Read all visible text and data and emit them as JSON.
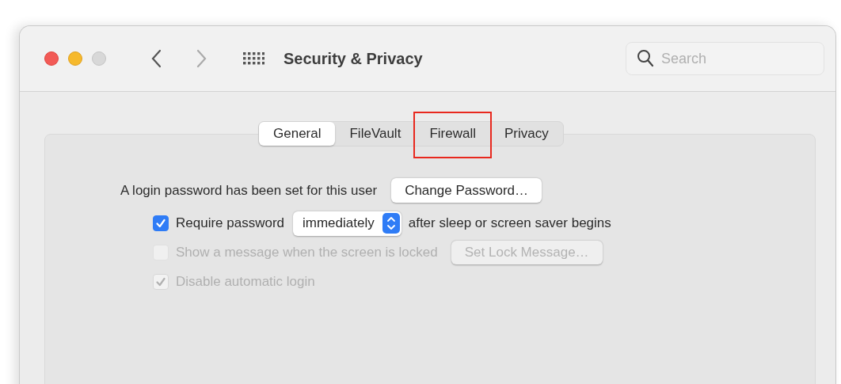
{
  "window": {
    "title": "Security & Privacy"
  },
  "search": {
    "placeholder": "Search"
  },
  "tabs": [
    {
      "label": "General",
      "selected": true,
      "highlighted": false
    },
    {
      "label": "FileVault",
      "selected": false,
      "highlighted": false
    },
    {
      "label": "Firewall",
      "selected": false,
      "highlighted": true
    },
    {
      "label": "Privacy",
      "selected": false,
      "highlighted": false
    }
  ],
  "login_row": {
    "text": "A login password has been set for this user",
    "button": {
      "label": "Change Password…",
      "disabled": false
    }
  },
  "options": [
    {
      "kind": "popup",
      "checked": true,
      "disabled": false,
      "label": "Require password",
      "popup": "immediately",
      "suffix": "after sleep or screen saver begins"
    },
    {
      "kind": "button",
      "checked": false,
      "disabled": true,
      "label": "Show a message when the screen is locked",
      "button": "Set Lock Message…"
    },
    {
      "kind": "plain",
      "checked": true,
      "disabled": true,
      "label": "Disable automatic login"
    }
  ]
}
